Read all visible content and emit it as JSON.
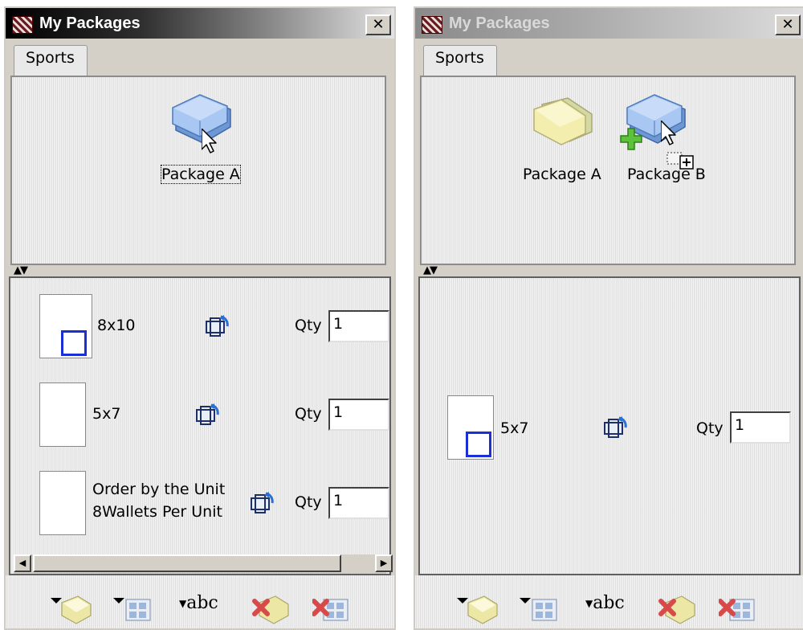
{
  "left_window": {
    "title": "My Packages",
    "close_label": "✕",
    "tab": "Sports",
    "packages": [
      {
        "label": "Package A",
        "color": "blue"
      }
    ],
    "items": [
      {
        "label_lines": [
          "8x10"
        ],
        "qty_label": "Qty",
        "qty": "1",
        "selected": true
      },
      {
        "label_lines": [
          "5x7"
        ],
        "qty_label": "Qty",
        "qty": "1",
        "selected": false
      },
      {
        "label_lines": [
          "Order by the Unit",
          "8Wallets Per Unit"
        ],
        "qty_label": "Qty",
        "qty": "1",
        "selected": false
      }
    ],
    "scrollbar": {
      "left_icon": "◀",
      "right_icon": "▶"
    }
  },
  "right_window": {
    "title": "My Packages",
    "close_label": "✕",
    "tab": "Sports",
    "packages": [
      {
        "label": "Package A",
        "color": "yellow"
      },
      {
        "label": "Package B",
        "color": "blue"
      }
    ],
    "items": [
      {
        "label_lines": [
          "5x7"
        ],
        "qty_label": "Qty",
        "qty": "1",
        "selected": true
      }
    ]
  },
  "toolbar": {
    "tools": [
      {
        "icon": "add-package-icon"
      },
      {
        "icon": "add-item-icon"
      },
      {
        "icon": "rename-icon",
        "text": "abc"
      },
      {
        "icon": "delete-package-icon"
      },
      {
        "icon": "delete-item-icon"
      }
    ]
  },
  "colors": {
    "selection_border": "#1a2fd6",
    "package_blue": "#8fb6ee",
    "package_yellow": "#f3eeae",
    "add_plus_green": "#5cc23a",
    "delete_red": "#d84a4a"
  }
}
